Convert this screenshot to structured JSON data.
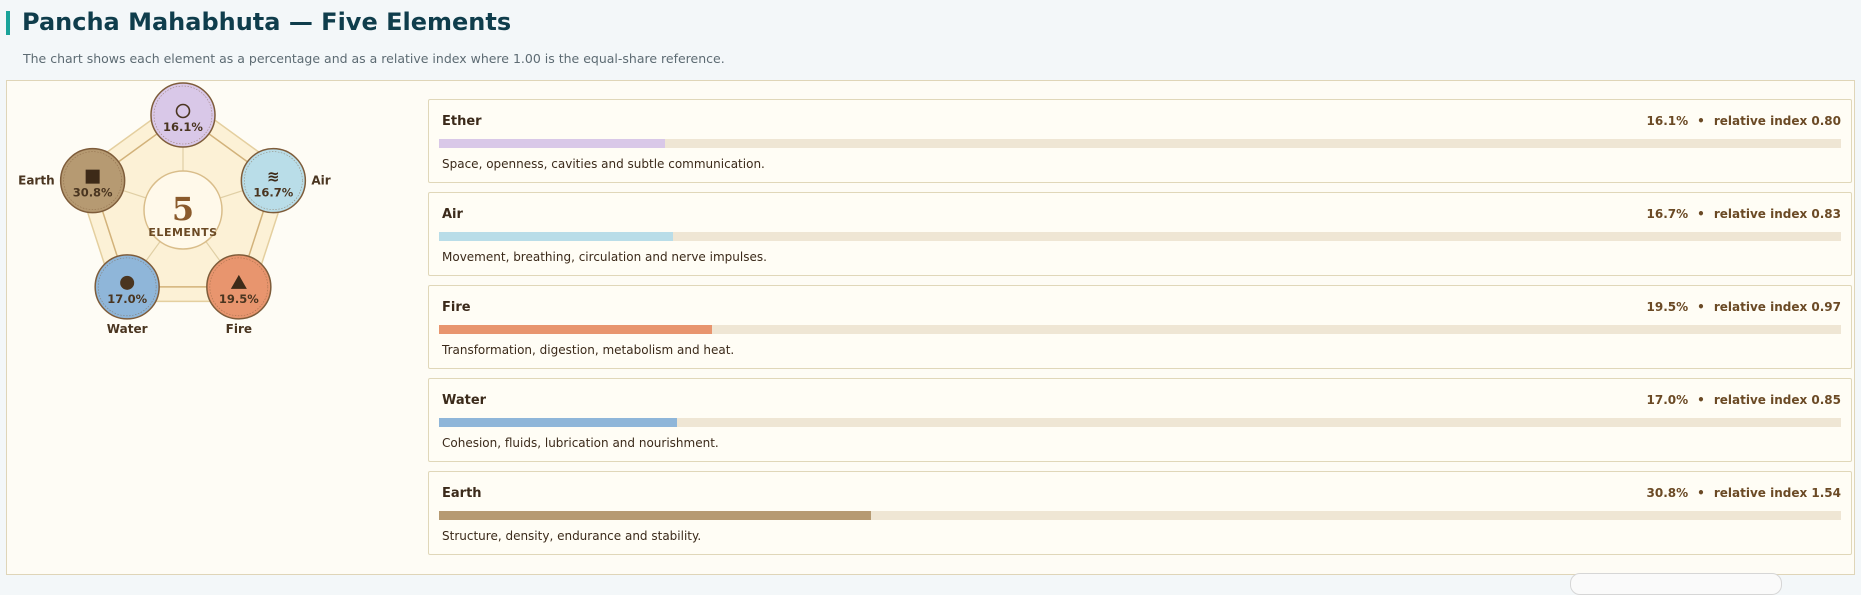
{
  "header": {
    "title": "Pancha Mahabhuta — Five Elements",
    "subtitle": "The chart shows each element as a percentage and as a relative index where 1.00 is the equal-share reference."
  },
  "wheel": {
    "center_number": "5",
    "center_label": "ELEMENTS"
  },
  "stats": {
    "separator": "•",
    "index_prefix": "relative index"
  },
  "chart_data": {
    "type": "bar",
    "title": "Pancha Mahabhuta — Five Elements",
    "unit": "%",
    "reference_index": 1.0,
    "xlim": [
      0,
      100
    ],
    "categories": [
      "Ether",
      "Air",
      "Fire",
      "Water",
      "Earth"
    ],
    "values": [
      16.1,
      16.7,
      19.5,
      17.0,
      30.8
    ],
    "relative_index": [
      0.8,
      0.83,
      0.97,
      0.85,
      1.54
    ],
    "elements": [
      {
        "name": "Ether",
        "percent": 16.1,
        "percent_label": "16.1%",
        "index": 0.8,
        "index_label": "0.80",
        "color": "#d9c8e8",
        "icon": "circle-outline-icon",
        "glyph": "○",
        "description": "Space, openness, cavities and subtle communication."
      },
      {
        "name": "Air",
        "percent": 16.7,
        "percent_label": "16.7%",
        "index": 0.83,
        "index_label": "0.83",
        "color": "#b9dde8",
        "icon": "wind-waves-icon",
        "glyph": "≋",
        "description": "Movement, breathing, circulation and nerve impulses."
      },
      {
        "name": "Fire",
        "percent": 19.5,
        "percent_label": "19.5%",
        "index": 0.97,
        "index_label": "0.97",
        "color": "#e8956e",
        "icon": "triangle-icon",
        "glyph": "▲",
        "description": "Transformation, digestion, metabolism and heat."
      },
      {
        "name": "Water",
        "percent": 17.0,
        "percent_label": "17.0%",
        "index": 0.85,
        "index_label": "0.85",
        "color": "#8fb6d9",
        "icon": "filled-circle-icon",
        "glyph": "●",
        "description": "Cohesion, fluids, lubrication and nourishment."
      },
      {
        "name": "Earth",
        "percent": 30.8,
        "percent_label": "30.8%",
        "index": 1.54,
        "index_label": "1.54",
        "color": "#b69a72",
        "icon": "square-icon",
        "glyph": "■",
        "description": "Structure, density, endurance and stability."
      }
    ]
  }
}
